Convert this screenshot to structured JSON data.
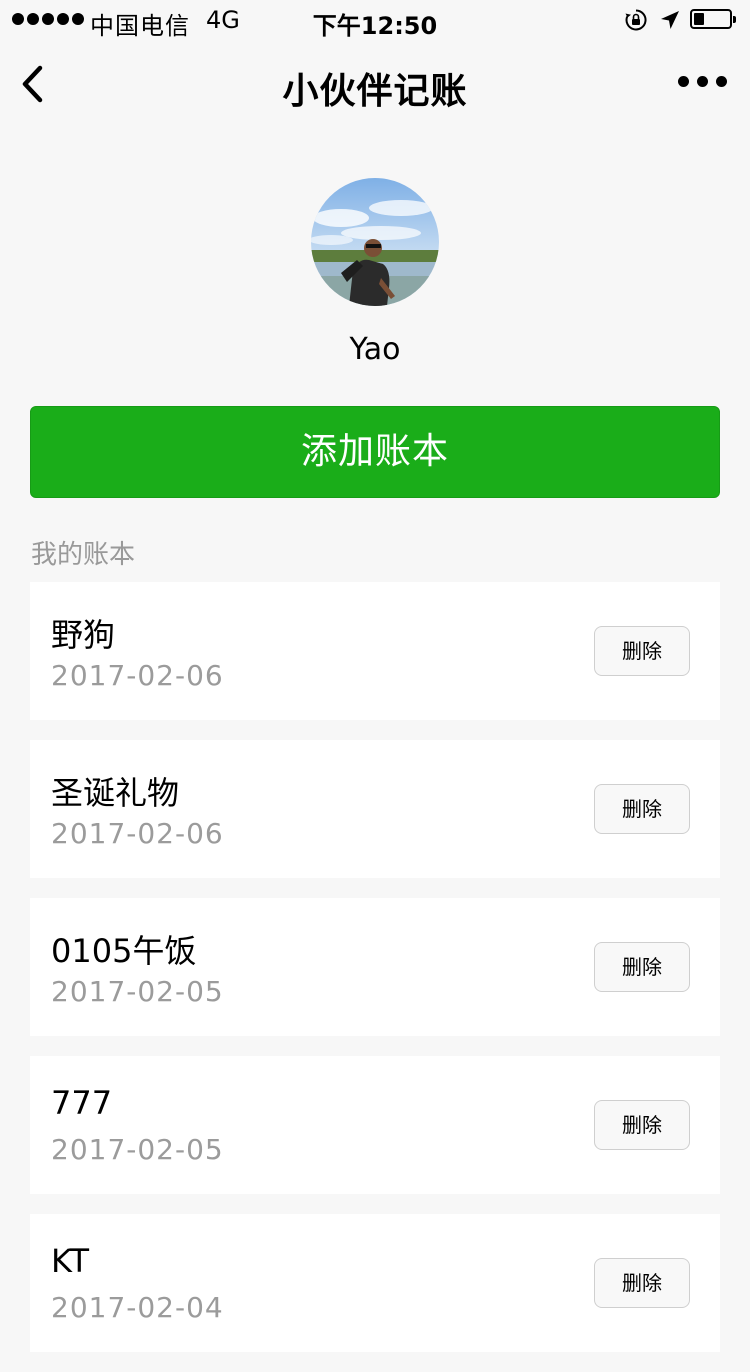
{
  "status_bar": {
    "carrier": "中国电信",
    "network": "4G",
    "time": "下午12:50",
    "battery_level_percent": 30
  },
  "nav": {
    "title": "小伙伴记账",
    "back_icon": "back-chevron-icon",
    "more_icon": "more-dots-icon"
  },
  "profile": {
    "name": "Yao"
  },
  "add_book_label": "添加账本",
  "section_label": "我的账本",
  "books": [
    {
      "name": "野狗",
      "date": "2017-02-06",
      "delete_label": "删除"
    },
    {
      "name": "圣诞礼物",
      "date": "2017-02-06",
      "delete_label": "删除"
    },
    {
      "name": "0105午饭",
      "date": "2017-02-05",
      "delete_label": "删除"
    },
    {
      "name": "777",
      "date": "2017-02-05",
      "delete_label": "删除"
    },
    {
      "name": "KT",
      "date": "2017-02-04",
      "delete_label": "删除"
    }
  ],
  "colors": {
    "accent": "#1aad19",
    "background": "#f7f7f7",
    "secondary_text": "#9b9b9b"
  }
}
